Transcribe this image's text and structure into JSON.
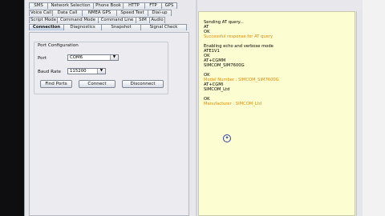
{
  "tabs": {
    "row1": [
      "SMS",
      "Network Selection",
      "Phone Book",
      "HTTP",
      "FTP",
      "GPS"
    ],
    "row2": [
      "Voice Call",
      "Data Call",
      "NMEA GPS",
      "Speed Test",
      "Dial-up"
    ],
    "row3": [
      "Script Mode",
      "Command Mode",
      "Command Line",
      "SIM",
      "Audio"
    ],
    "row4": [
      "Connection",
      "Diagnostics",
      "Snapshot",
      "Signal Check"
    ],
    "selected": "Connection"
  },
  "port_config": {
    "title": "Port Configuration",
    "port_label": "Port",
    "port_value": "COM6",
    "baud_label": "Baud Rate",
    "baud_value": "115200",
    "find_ports": "Find Ports",
    "connect": "Connect",
    "disconnect": "Disconnect"
  },
  "log": {
    "lines": [
      {
        "text": "Sending AT query...",
        "color": "#000000"
      },
      {
        "text": "AT",
        "color": "#000000"
      },
      {
        "text": "OK",
        "color": "#000000"
      },
      {
        "text": "Successful response for AT query",
        "color": "#e08a00"
      },
      {
        "text": "",
        "color": "#000000"
      },
      {
        "text": "Enabling echo and verbose mode",
        "color": "#000000"
      },
      {
        "text": "ATE1V1",
        "color": "#000000"
      },
      {
        "text": "OK",
        "color": "#000000"
      },
      {
        "text": "AT+CGMM",
        "color": "#000000"
      },
      {
        "text": "SIMCOM_SIM7600G",
        "color": "#000000"
      },
      {
        "text": "",
        "color": "#000000"
      },
      {
        "text": "OK",
        "color": "#000000"
      },
      {
        "text": "Model Number : SIMCOM_SIM7600G",
        "color": "#e08a00"
      },
      {
        "text": "AT+CGMI",
        "color": "#000000"
      },
      {
        "text": "SIMCOM_Ltd",
        "color": "#000000"
      },
      {
        "text": "",
        "color": "#000000"
      },
      {
        "text": "OK",
        "color": "#000000"
      },
      {
        "text": "Manufacturer : SIMCOM_Ltd",
        "color": "#e08a00"
      }
    ]
  },
  "colors": {
    "log_background": "#fcfdd0",
    "highlight_text": "#e08a00"
  }
}
